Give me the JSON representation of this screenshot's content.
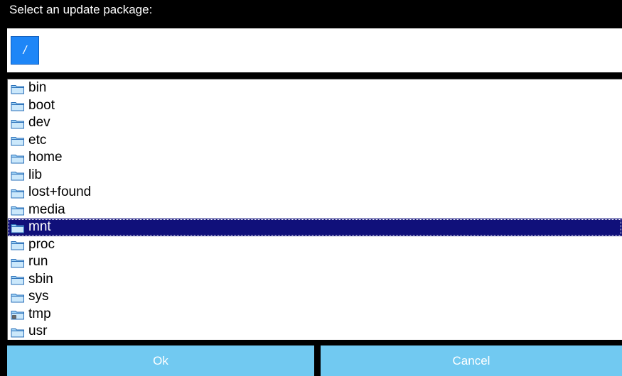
{
  "dialog": {
    "title": "Select an update package:"
  },
  "path": {
    "crumbs": [
      "/"
    ]
  },
  "files": [
    {
      "name": "bin",
      "icon": "folder-icon",
      "selected": false
    },
    {
      "name": "boot",
      "icon": "folder-icon",
      "selected": false
    },
    {
      "name": "dev",
      "icon": "folder-icon",
      "selected": false
    },
    {
      "name": "etc",
      "icon": "folder-icon",
      "selected": false
    },
    {
      "name": "home",
      "icon": "folder-icon",
      "selected": false
    },
    {
      "name": "lib",
      "icon": "folder-icon",
      "selected": false
    },
    {
      "name": "lost+found",
      "icon": "folder-icon",
      "selected": false
    },
    {
      "name": "media",
      "icon": "folder-icon",
      "selected": false
    },
    {
      "name": "mnt",
      "icon": "folder-icon",
      "selected": true
    },
    {
      "name": "proc",
      "icon": "folder-icon",
      "selected": false
    },
    {
      "name": "run",
      "icon": "folder-icon",
      "selected": false
    },
    {
      "name": "sbin",
      "icon": "folder-icon",
      "selected": false
    },
    {
      "name": "sys",
      "icon": "folder-icon",
      "selected": false
    },
    {
      "name": "tmp",
      "icon": "folder-shared-icon",
      "selected": false
    },
    {
      "name": "usr",
      "icon": "folder-icon",
      "selected": false
    }
  ],
  "buttons": {
    "ok_label": "Ok",
    "cancel_label": "Cancel"
  },
  "colors": {
    "selection": "#10107a",
    "button": "#71c9f1",
    "crumb": "#1e86f7"
  }
}
